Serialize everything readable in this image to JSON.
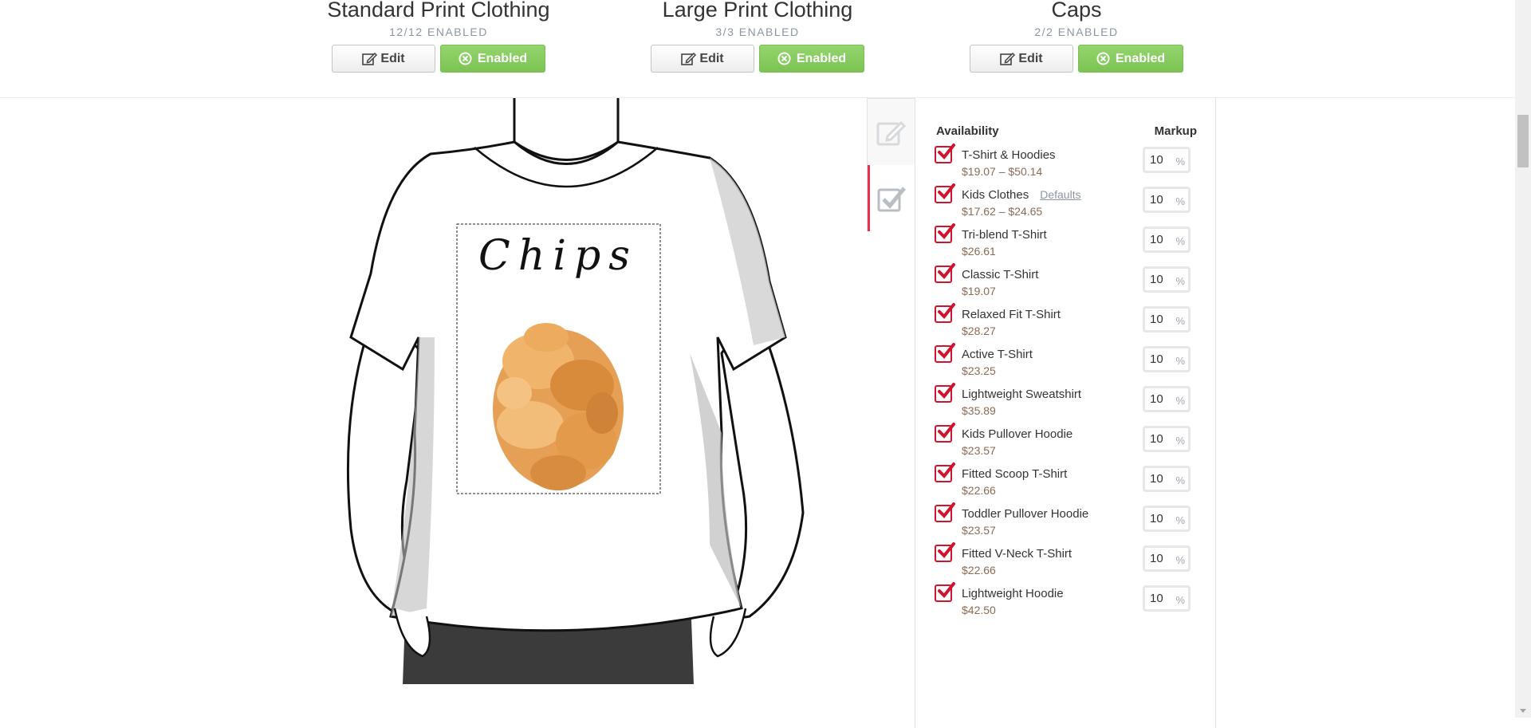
{
  "products": [
    {
      "title": "Standard Print Clothing",
      "count": "12/12 ENABLED",
      "edit_label": "Edit",
      "enabled_label": "Enabled"
    },
    {
      "title": "Large Print Clothing",
      "count": "3/3 ENABLED",
      "edit_label": "Edit",
      "enabled_label": "Enabled"
    },
    {
      "title": "Caps",
      "count": "2/2 ENABLED",
      "edit_label": "Edit",
      "enabled_label": "Enabled"
    }
  ],
  "design": {
    "text": "Chips"
  },
  "side_tabs": [
    {
      "icon": "edit-icon",
      "active": false
    },
    {
      "icon": "checkbox-icon",
      "active": true
    }
  ],
  "availability": {
    "header_availability": "Availability",
    "header_markup": "Markup",
    "percent_symbol": "%",
    "items": [
      {
        "name": "T-Shirt & Hoodies",
        "price": "$19.07 – $50.14",
        "markup": "10",
        "checked": true
      },
      {
        "name": "Kids Clothes",
        "link": "Defaults",
        "price": "$17.62 – $24.65",
        "markup": "10",
        "checked": true
      },
      {
        "name": "Tri-blend T-Shirt",
        "price": "$26.61",
        "markup": "10",
        "checked": true
      },
      {
        "name": "Classic T-Shirt",
        "price": "$19.07",
        "markup": "10",
        "checked": true
      },
      {
        "name": "Relaxed Fit T-Shirt",
        "price": "$28.27",
        "markup": "10",
        "checked": true
      },
      {
        "name": "Active T-Shirt",
        "price": "$23.25",
        "markup": "10",
        "checked": true
      },
      {
        "name": "Lightweight Sweatshirt",
        "price": "$35.89",
        "markup": "10",
        "checked": true
      },
      {
        "name": "Kids Pullover Hoodie",
        "price": "$23.57",
        "markup": "10",
        "checked": true
      },
      {
        "name": "Fitted Scoop T-Shirt",
        "price": "$22.66",
        "markup": "10",
        "checked": true
      },
      {
        "name": "Toddler Pullover Hoodie",
        "price": "$23.57",
        "markup": "10",
        "checked": true
      },
      {
        "name": "Fitted V-Neck T-Shirt",
        "price": "$22.66",
        "markup": "10",
        "checked": true
      },
      {
        "name": "Lightweight Hoodie",
        "price": "$42.50",
        "markup": "10",
        "checked": true
      }
    ]
  },
  "colors": {
    "accent_red": "#d0142d",
    "enabled_green": "#84c95c"
  }
}
